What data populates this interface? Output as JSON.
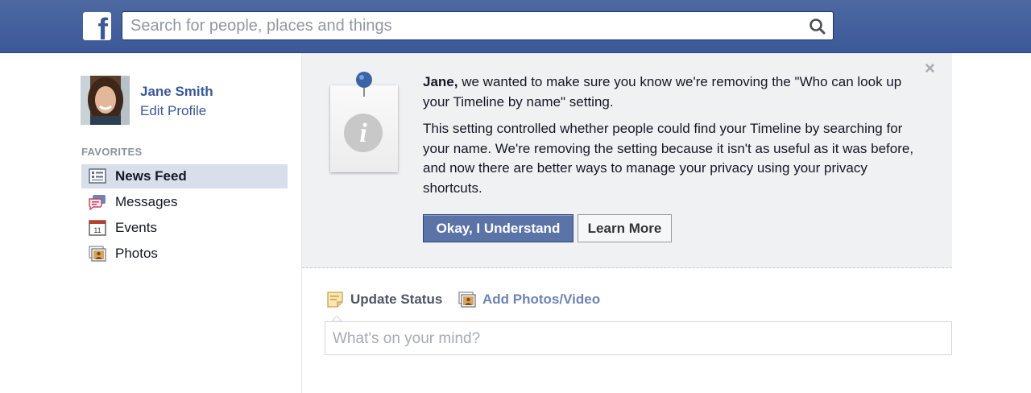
{
  "header": {
    "logo_letter": "f",
    "logo_icon": "facebook-logo",
    "search_placeholder": "Search for people, places and things",
    "search_icon": "magnifier-icon",
    "brand_color": "#3b5998"
  },
  "sidebar": {
    "profile": {
      "name": "Jane Smith",
      "edit_label": "Edit Profile"
    },
    "favorites_header": "FAVORITES",
    "items": [
      {
        "label": "News Feed",
        "icon": "news-feed-icon",
        "active": true
      },
      {
        "label": "Messages",
        "icon": "messages-icon",
        "active": false
      },
      {
        "label": "Events",
        "icon": "calendar-icon",
        "active": false,
        "icon_text": "11"
      },
      {
        "label": "Photos",
        "icon": "photos-icon",
        "active": false
      }
    ]
  },
  "notice": {
    "close_glyph": "×",
    "lead_name": "Jane,",
    "lead_text": " we wanted to make sure you know we're removing the \"Who can look up your Timeline by name\" setting.",
    "body_text": "This setting controlled whether people could find your Timeline by searching for your name. We're removing the setting because it isn't as useful as it was before, and now there are better ways to manage your privacy using your privacy shortcuts.",
    "primary_button": "Okay, I Understand",
    "secondary_button": "Learn More",
    "icon_letter": "i"
  },
  "composer": {
    "tabs": [
      {
        "label": "Update Status",
        "icon": "status-note-icon"
      },
      {
        "label": "Add Photos/Video",
        "icon": "photos-icon"
      }
    ],
    "placeholder": "What's on your mind?"
  }
}
